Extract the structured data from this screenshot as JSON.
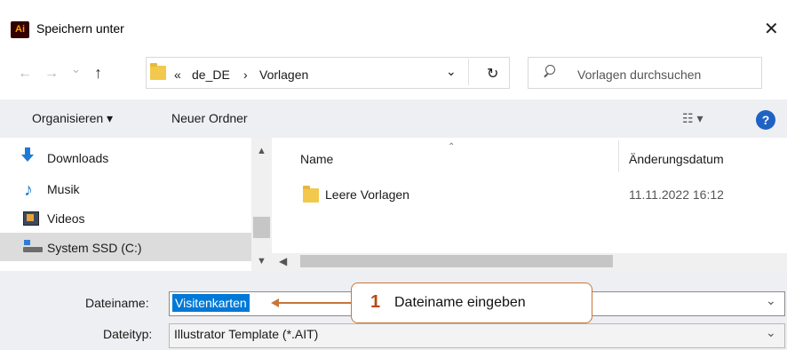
{
  "window": {
    "app_badge": "Ai",
    "title": "Speichern unter",
    "close_glyph": "✕"
  },
  "address": {
    "back_glyph": "←",
    "forward_glyph": "→",
    "history_glyph": "⌄",
    "up_glyph": "↑",
    "overflow": "«",
    "breadcrumb": [
      "de_DE",
      "Vorlagen"
    ],
    "separator": "›",
    "dropdown_glyph": "⌄",
    "refresh_glyph": "↻",
    "search_placeholder": "Vorlagen durchsuchen"
  },
  "toolbar": {
    "organize_label": "Organisieren ▾",
    "new_folder_label": "Neuer Ordner",
    "view_glyph": "☷ ▾",
    "help_glyph": "?"
  },
  "nav": {
    "items": [
      {
        "label": "Downloads",
        "icon": "download-arrow-icon"
      },
      {
        "label": "Musik",
        "icon": "music-note-icon"
      },
      {
        "label": "Videos",
        "icon": "film-icon"
      },
      {
        "label": "System SSD (C:)",
        "icon": "drive-icon"
      }
    ]
  },
  "files": {
    "columns": {
      "name": "Name",
      "date": "Änderungsdatum"
    },
    "rows": [
      {
        "name": "Leere Vorlagen",
        "date": "11.11.2022 16:12"
      }
    ]
  },
  "form": {
    "filename_label": "Dateiname:",
    "filename_value": "Visitenkarten",
    "filetype_label": "Dateityp:",
    "filetype_value": "Illustrator Template (*.AIT)"
  },
  "annotation": {
    "number": "1",
    "text": "Dateiname eingeben"
  },
  "colors": {
    "accent": "#0078d7",
    "callout_border": "#c8763a",
    "callout_number": "#b84a10",
    "folder": "#f2c94c"
  }
}
